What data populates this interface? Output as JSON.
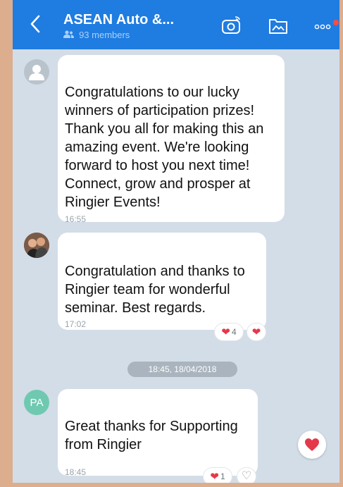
{
  "header": {
    "back_icon": "chevron-left-icon",
    "title": "ASEAN Auto &...",
    "members_icon": "members-icon",
    "members": "93 members",
    "camera_icon": "camera-icon",
    "album_icon": "album-icon",
    "more_icon": "more-icon"
  },
  "messages": [
    {
      "avatar": "",
      "text": "Congratulations to our lucky winners of participation prizes! Thank you all for making this an amazing event. We're looking forward to host you next time! Connect, grow and prosper at Ringier Events!",
      "time": "16:55"
    },
    {
      "avatar": "",
      "text": "Congratulation and thanks to Ringier team for wonderful seminar. Best regards.",
      "time": "17:02",
      "reaction_count": "4"
    },
    {
      "avatar": "PA",
      "text": "Great thanks for Supporting from Ringier",
      "time": "18:45",
      "reaction_count": "1"
    }
  ],
  "date_separator": "18:45, 18/04/2018",
  "colors": {
    "header": "#1f7ce1",
    "heart": "#e5384a",
    "background": "#d3dde7"
  }
}
